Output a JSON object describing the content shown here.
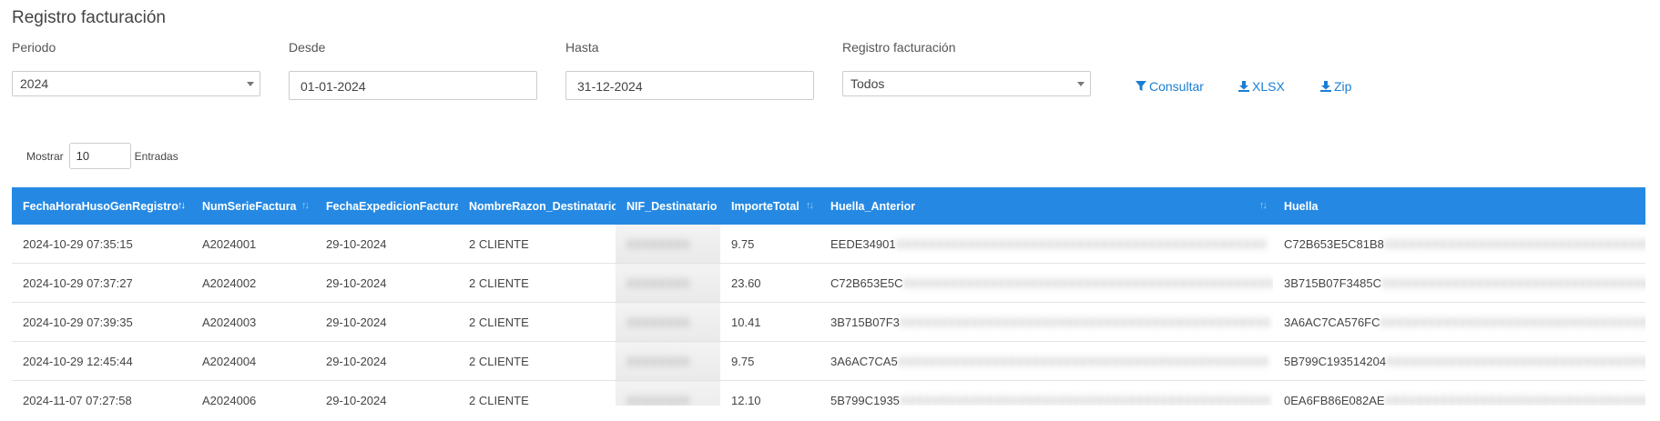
{
  "page_title": "Registro facturación",
  "filters": {
    "periodo": {
      "label": "Periodo",
      "value": "2024"
    },
    "desde": {
      "label": "Desde",
      "value": "01-01-2024"
    },
    "hasta": {
      "label": "Hasta",
      "value": "31-12-2024"
    },
    "registro": {
      "label": "Registro facturación",
      "value": "Todos"
    }
  },
  "actions": {
    "consultar": "Consultar",
    "xlsx": "XLSX",
    "zip": "Zip"
  },
  "length": {
    "prefix": "Mostrar",
    "value": "10",
    "suffix": "Entradas"
  },
  "table": {
    "columns": [
      "FechaHoraHusoGenRegistro",
      "NumSerieFactura",
      "FechaExpedicionFactura",
      "NombreRazon_Destinatario",
      "NIF_Destinatario",
      "ImporteTotal",
      "Huella_Anterior",
      "Huella"
    ],
    "rows": [
      [
        "2024-10-29 07:35:15",
        "A2024001",
        "29-10-2024",
        "2 CLIENTE",
        "",
        "9.75",
        "EEDE34901",
        "C72B653E5C81B8"
      ],
      [
        "2024-10-29 07:37:27",
        "A2024002",
        "29-10-2024",
        "2 CLIENTE",
        "",
        "23.60",
        "C72B653E5C",
        "3B715B07F3485C"
      ],
      [
        "2024-10-29 07:39:35",
        "A2024003",
        "29-10-2024",
        "2 CLIENTE",
        "",
        "10.41",
        "3B715B07F3",
        "3A6AC7CA576FC"
      ],
      [
        "2024-10-29 12:45:44",
        "A2024004",
        "29-10-2024",
        "2 CLIENTE",
        "",
        "9.75",
        "3A6AC7CA5",
        "5B799C193514204"
      ],
      [
        "2024-11-07 07:27:58",
        "A2024006",
        "29-10-2024",
        "2 CLIENTE",
        "",
        "12.10",
        "5B799C1935",
        "0EA6FB86E082AE"
      ]
    ]
  },
  "colors": {
    "header": "#2589e3",
    "accent": "#1a7ed4"
  }
}
